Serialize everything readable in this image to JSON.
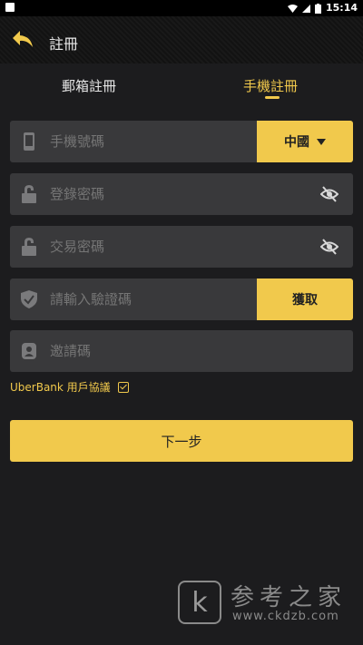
{
  "status_bar": {
    "time": "15:14"
  },
  "header": {
    "title": "註冊",
    "back_icon": "arrow-back-icon"
  },
  "tabs": [
    {
      "label": "郵箱註冊",
      "active": false
    },
    {
      "label": "手機註冊",
      "active": true
    }
  ],
  "form": {
    "phone": {
      "placeholder": "手機號碼",
      "country": "中國"
    },
    "login_password": {
      "placeholder": "登錄密碼"
    },
    "trade_password": {
      "placeholder": "交易密碼"
    },
    "verify_code": {
      "placeholder": "請輸入驗證碼",
      "button": "獲取"
    },
    "invite_code": {
      "placeholder": "邀請碼"
    }
  },
  "agreement": {
    "label": "UberBank 用戶協議",
    "checked": true
  },
  "next_button": "下一步",
  "watermark": {
    "logo": "k",
    "text": "参考之家",
    "url": "www.ckdzb.com"
  },
  "colors": {
    "accent": "#f1c94c",
    "background": "#1c1c1e",
    "field": "#39393b"
  }
}
